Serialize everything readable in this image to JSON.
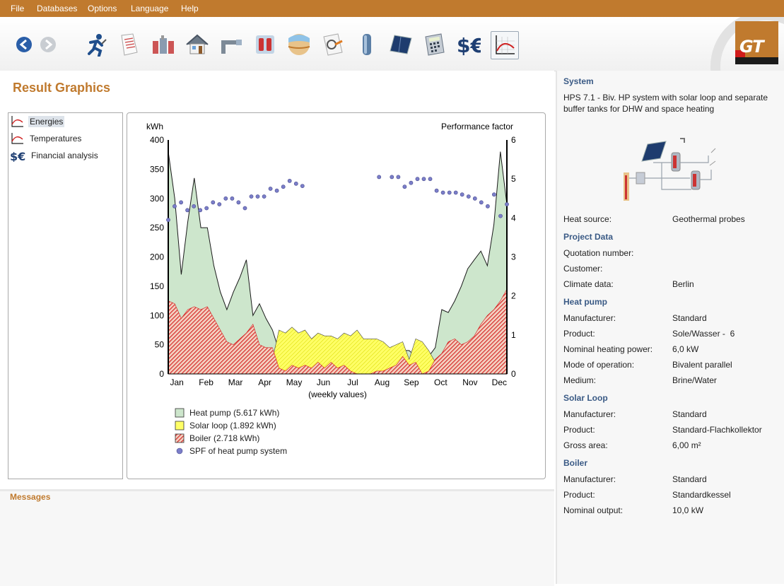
{
  "menu": [
    "File",
    "Databases",
    "Options",
    "Language",
    "Help"
  ],
  "toolbar": {
    "icons": [
      "back-icon",
      "forward-icon",
      "runner-icon",
      "document-icon",
      "heat-pump-icon",
      "house-icon",
      "pipe-icon",
      "buffer-tank-icon",
      "geothermal-icon",
      "hot-water-icon",
      "storage-tank-icon",
      "solar-panel-icon",
      "calculator-icon",
      "dollar-euro-icon",
      "result-graph-icon"
    ],
    "logo_text": "GT"
  },
  "page_title": "Result Graphics",
  "nav": [
    {
      "label": "Energies",
      "selected": true,
      "icon": "energies-graph-icon"
    },
    {
      "label": "Temperatures",
      "selected": false,
      "icon": "temperatures-graph-icon"
    },
    {
      "label": "Financial analysis",
      "selected": false,
      "icon": "dollar-euro-icon"
    }
  ],
  "chart_data": {
    "type": "area",
    "y_left_label": "kWh",
    "y_right_label": "Performance factor",
    "xlabel": "(weekly values)",
    "months": [
      "Jan",
      "Feb",
      "Mar",
      "Apr",
      "May",
      "Jun",
      "Jul",
      "Aug",
      "Sep",
      "Oct",
      "Nov",
      "Dec"
    ],
    "ylim_left": [
      0,
      400
    ],
    "yticks_left": [
      0,
      50,
      100,
      150,
      200,
      250,
      300,
      350,
      400
    ],
    "ylim_right": [
      0,
      6
    ],
    "yticks_right": [
      0,
      1,
      2,
      3,
      4,
      5,
      6
    ],
    "weeks": 53,
    "series": [
      {
        "name": "Heat pump (5.617 kWh)",
        "color": "#cde6cc",
        "values": [
          380,
          300,
          170,
          260,
          335,
          250,
          250,
          185,
          140,
          110,
          140,
          165,
          195,
          100,
          120,
          95,
          75,
          40,
          40,
          40,
          38,
          32,
          30,
          30,
          28,
          25,
          22,
          20,
          20,
          18,
          18,
          20,
          20,
          22,
          25,
          35,
          40,
          40,
          30,
          25,
          30,
          45,
          110,
          105,
          125,
          150,
          180,
          195,
          210,
          185,
          255,
          380,
          290
        ]
      },
      {
        "name": "Solar loop (1.892 kWh)",
        "color": "#ffff66",
        "values": [
          20,
          25,
          20,
          25,
          20,
          20,
          20,
          18,
          15,
          15,
          15,
          20,
          15,
          15,
          15,
          20,
          25,
          75,
          70,
          80,
          70,
          75,
          60,
          70,
          65,
          65,
          60,
          70,
          65,
          75,
          60,
          60,
          60,
          55,
          45,
          50,
          55,
          25,
          60,
          55,
          40,
          20,
          20,
          20,
          15,
          15,
          15,
          15,
          20,
          10,
          15,
          15,
          10
        ]
      },
      {
        "name": "Boiler (2.718 kWh)",
        "color": "#d42020",
        "values": [
          125,
          120,
          95,
          110,
          115,
          110,
          115,
          95,
          75,
          55,
          50,
          60,
          70,
          85,
          50,
          45,
          45,
          10,
          5,
          15,
          10,
          15,
          10,
          20,
          10,
          20,
          10,
          15,
          5,
          0,
          0,
          0,
          5,
          5,
          10,
          15,
          30,
          15,
          20,
          0,
          5,
          25,
          35,
          55,
          60,
          50,
          55,
          65,
          85,
          100,
          110,
          125,
          145
        ]
      }
    ],
    "spf_series": {
      "name": "SPF of heat pump system",
      "color": "#7b7ec9",
      "values": [
        3.95,
        4.3,
        4.4,
        4.2,
        4.3,
        4.2,
        4.25,
        4.4,
        4.35,
        4.5,
        4.5,
        4.4,
        4.25,
        4.55,
        4.55,
        4.55,
        4.75,
        4.7,
        4.8,
        4.95,
        4.88,
        4.82,
        null,
        null,
        null,
        null,
        null,
        null,
        null,
        null,
        null,
        null,
        null,
        5.05,
        null,
        5.05,
        5.05,
        4.8,
        4.9,
        5.0,
        5.0,
        5.0,
        4.7,
        4.65,
        4.65,
        4.65,
        4.6,
        4.55,
        4.5,
        4.4,
        4.3,
        4.6,
        4.05,
        4.35
      ]
    }
  },
  "messages_title": "Messages",
  "system": {
    "section": "System",
    "description_line1": "HPS 7.1 - Biv. HP system with solar loop and separate",
    "description_line2": "buffer tanks for DHW and space heating",
    "heat_source_label": "Heat source:",
    "heat_source_value": "Geothermal probes"
  },
  "project": {
    "section": "Project Data",
    "quotation_label": "Quotation number:",
    "customer_label": "Customer:",
    "climate_label": "Climate data:",
    "climate_value": "Berlin"
  },
  "heat_pump": {
    "section": "Heat pump",
    "manufacturer_label": "Manufacturer:",
    "manufacturer_value": "Standard",
    "product_label": "Product:",
    "product_value": "Sole/Wasser -  6",
    "power_label": "Nominal heating power:",
    "power_value": "6,0 kW",
    "mode_label": "Mode of operation:",
    "mode_value": "Bivalent parallel",
    "medium_label": "Medium:",
    "medium_value": "Brine/Water"
  },
  "solar_loop": {
    "section": "Solar Loop",
    "manufacturer_label": "Manufacturer:",
    "manufacturer_value": "Standard",
    "product_label": "Product:",
    "product_value": "Standard-Flachkollektor",
    "area_label": "Gross area:",
    "area_value": "6,00 m²"
  },
  "boiler": {
    "section": "Boiler",
    "manufacturer_label": "Manufacturer:",
    "manufacturer_value": "Standard",
    "product_label": "Product:",
    "product_value": "Standardkessel",
    "output_label": "Nominal output:",
    "output_value": "10,0 kW"
  }
}
